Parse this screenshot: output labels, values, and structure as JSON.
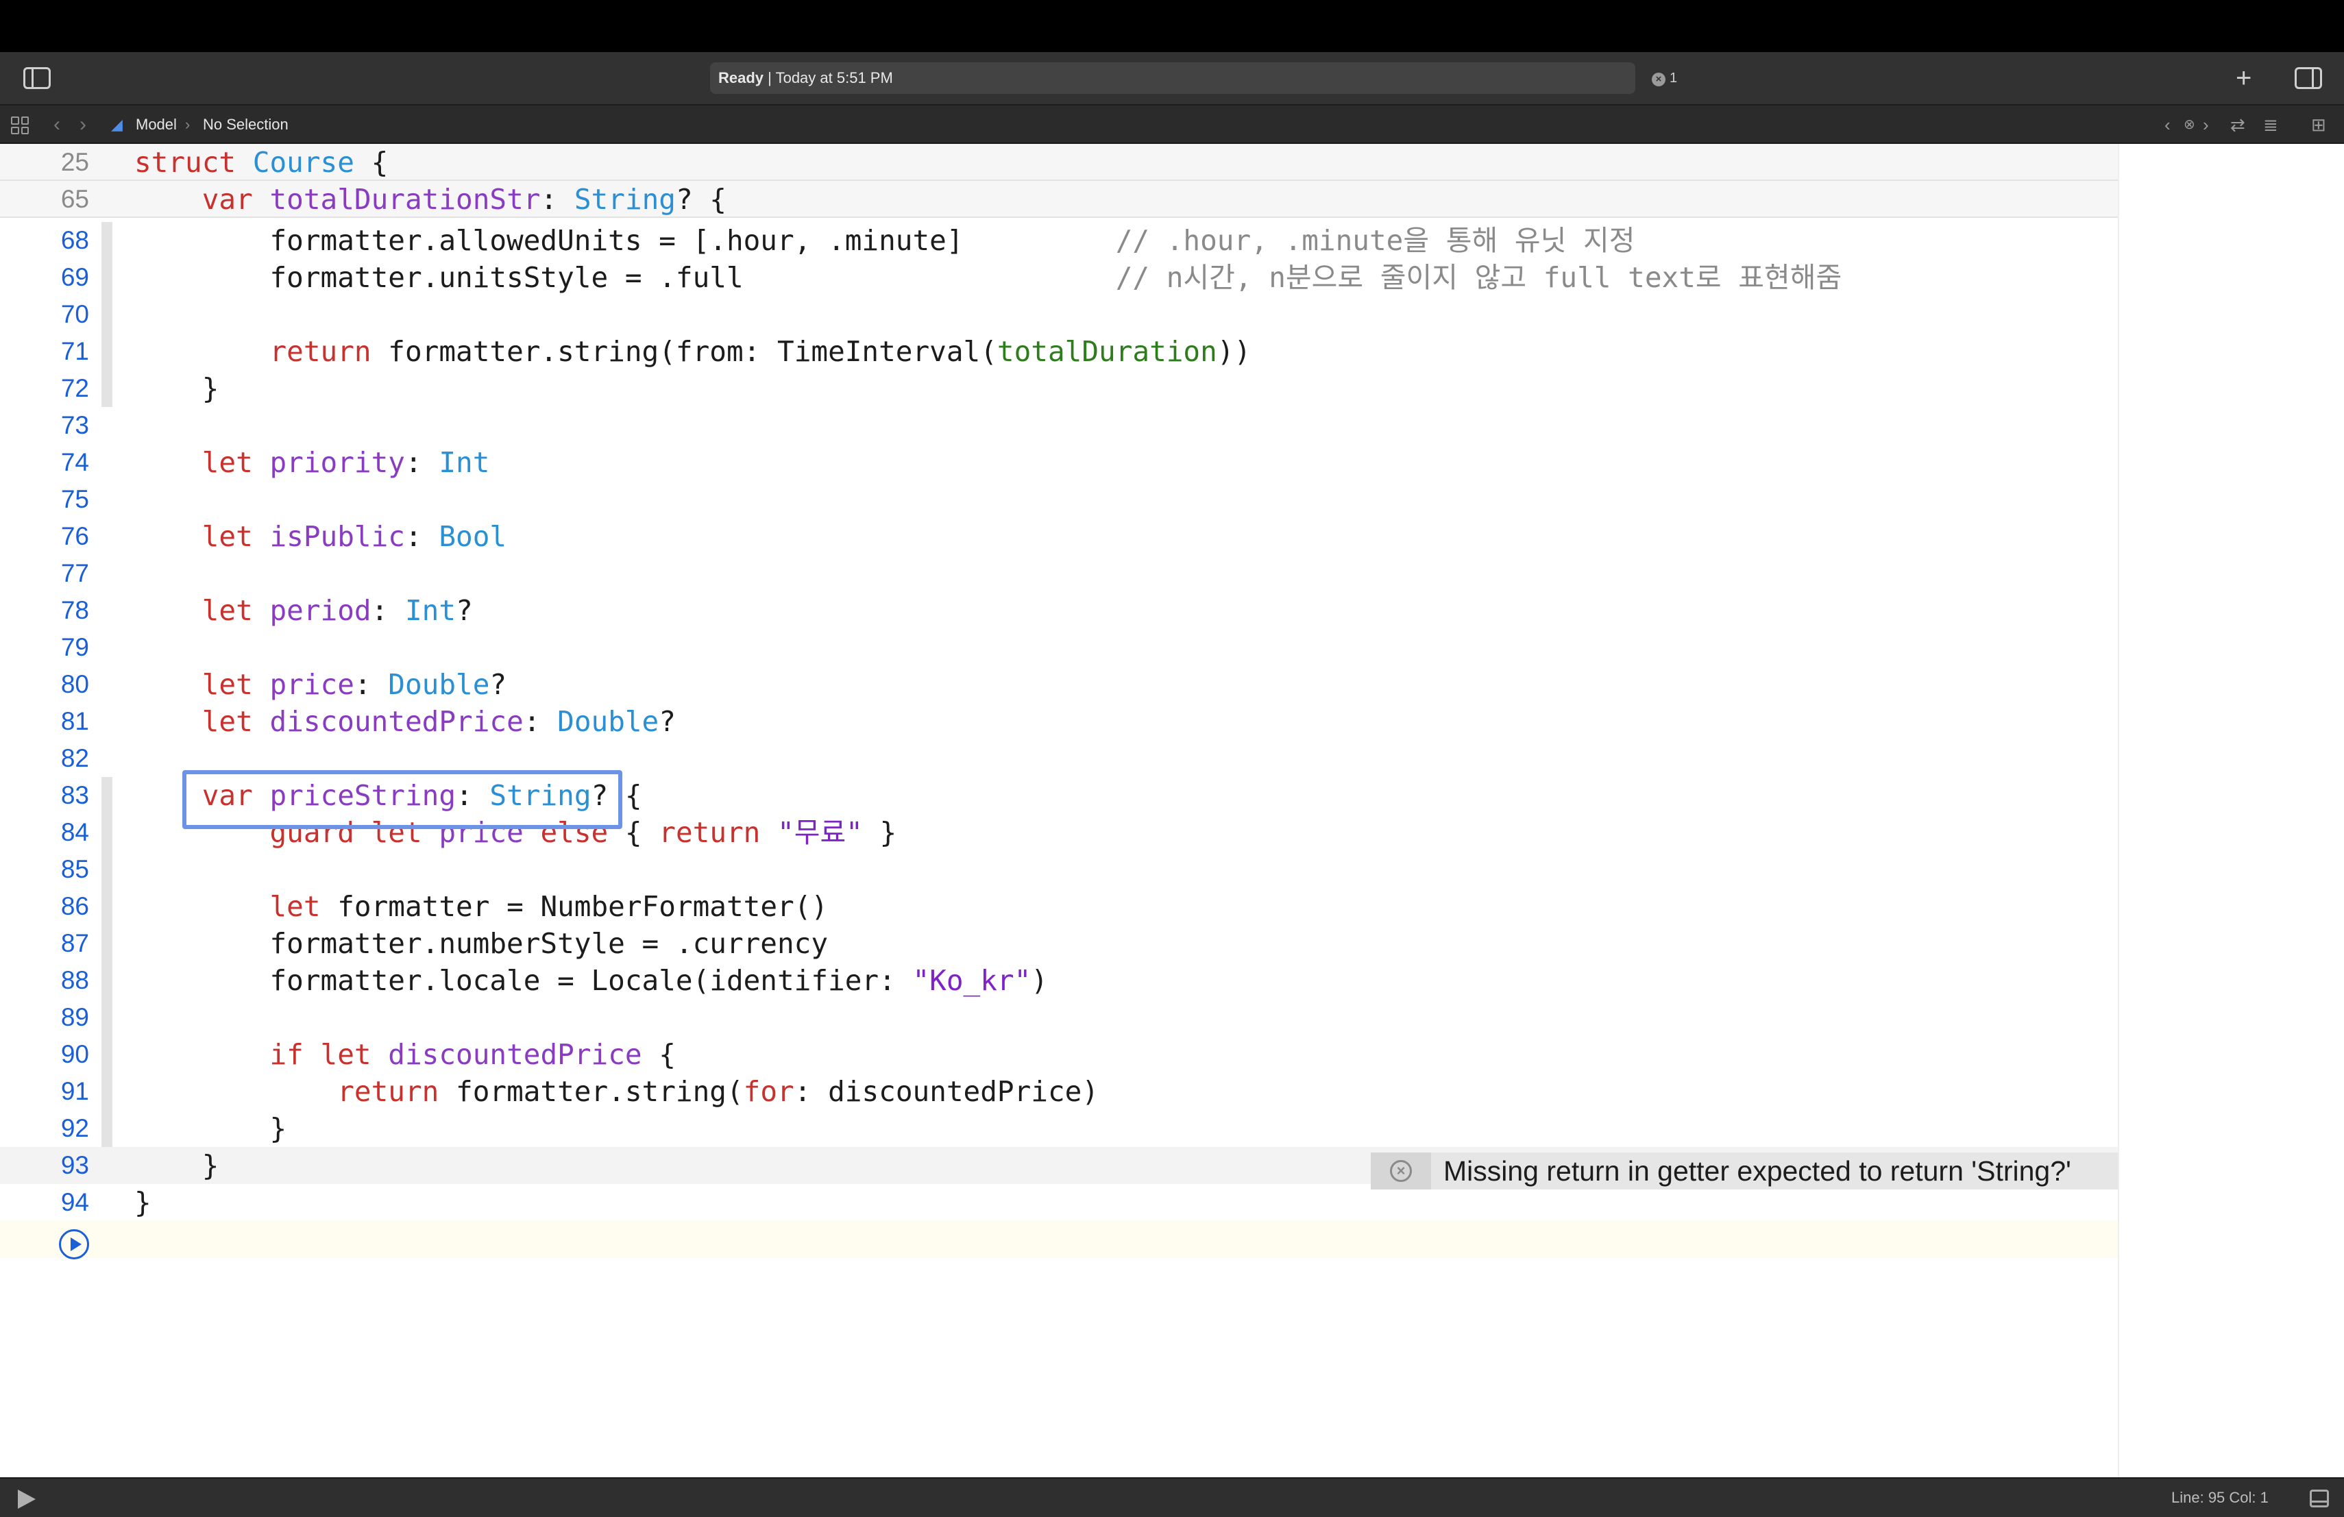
{
  "toolbar": {
    "status_bold": "Ready",
    "status_rest": " | Today at 5:51 PM",
    "error_count": "1",
    "add_label": "+"
  },
  "jumpbar": {
    "breadcrumb_file": "Model",
    "breadcrumb_symbol": "No Selection"
  },
  "editor": {
    "sticky_lines": [
      {
        "number": "25",
        "code": "struct Course {"
      },
      {
        "number": "65",
        "code": "    var totalDurationStr: String? {"
      }
    ],
    "lines": [
      {
        "number": "68",
        "code": "        formatter.allowedUnits = [.hour, .minute]         // .hour, .minute을 통해 유닛 지정"
      },
      {
        "number": "69",
        "code": "        formatter.unitsStyle = .full                      // n시간, n분으로 줄이지 않고 full text로 표현해줌"
      },
      {
        "number": "70",
        "code": ""
      },
      {
        "number": "71",
        "code": "        return formatter.string(from: TimeInterval(totalDuration))"
      },
      {
        "number": "72",
        "code": "    }"
      },
      {
        "number": "73",
        "code": ""
      },
      {
        "number": "74",
        "code": "    let priority: Int"
      },
      {
        "number": "75",
        "code": ""
      },
      {
        "number": "76",
        "code": "    let isPublic: Bool"
      },
      {
        "number": "77",
        "code": ""
      },
      {
        "number": "78",
        "code": "    let period: Int?"
      },
      {
        "number": "79",
        "code": ""
      },
      {
        "number": "80",
        "code": "    let price: Double?"
      },
      {
        "number": "81",
        "code": "    let discountedPrice: Double?"
      },
      {
        "number": "82",
        "code": ""
      },
      {
        "number": "83",
        "code": "    var priceString: String? {"
      },
      {
        "number": "84",
        "code": "        guard let price else { return \"무료\" }"
      },
      {
        "number": "85",
        "code": ""
      },
      {
        "number": "86",
        "code": "        let formatter = NumberFormatter()"
      },
      {
        "number": "87",
        "code": "        formatter.numberStyle = .currency"
      },
      {
        "number": "88",
        "code": "        formatter.locale = Locale(identifier: \"Ko_kr\")"
      },
      {
        "number": "89",
        "code": ""
      },
      {
        "number": "90",
        "code": "        if let discountedPrice {"
      },
      {
        "number": "91",
        "code": "            return formatter.string(for: discountedPrice)"
      },
      {
        "number": "92",
        "code": "        }"
      },
      {
        "number": "93",
        "code": "    }"
      },
      {
        "number": "94",
        "code": "}"
      }
    ],
    "issue_message": "Missing return in getter expected to return 'String?'"
  },
  "bottombar": {
    "line_col": "Line: 95  Col: 1"
  },
  "colors": {
    "keyword": "#c8322e",
    "property": "#8a3cc1",
    "type": "#2b8fd4",
    "string": "#7e24c7",
    "comment": "#8a8a8a",
    "line_number": "#1a5fd6",
    "highlight_box": "#6c93e6"
  }
}
